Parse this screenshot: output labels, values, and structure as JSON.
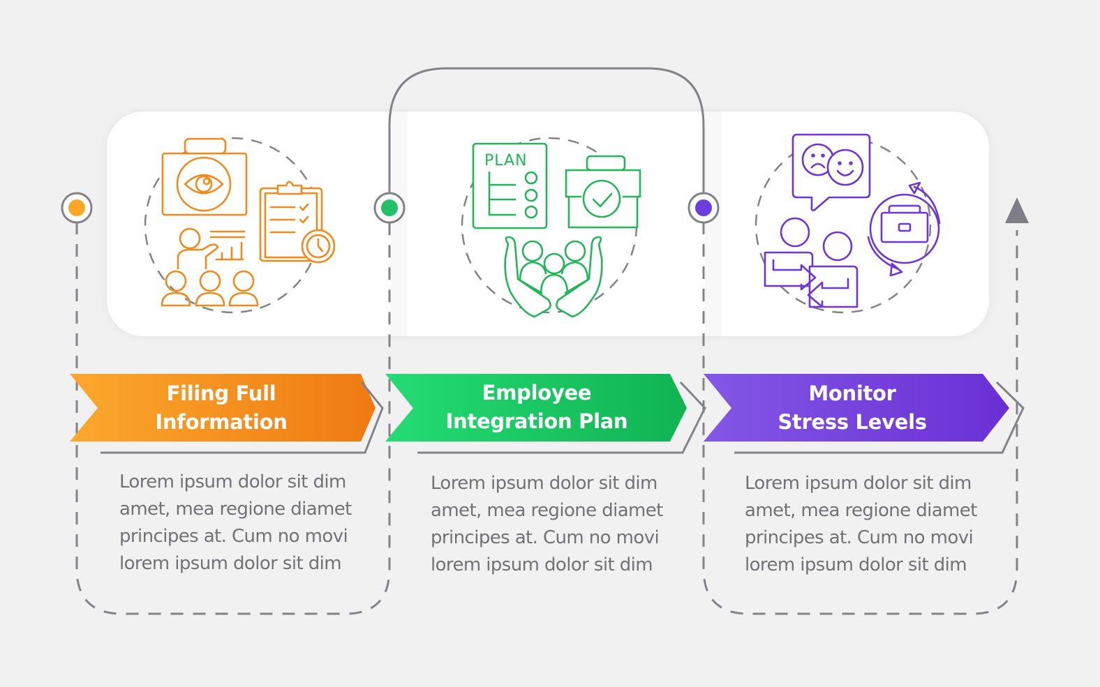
{
  "infographic": {
    "steps": [
      {
        "title_line1": "Filing Full",
        "title_line2": "Information",
        "description": "Lorem ipsum dolor sit dim amet, mea regione diamet principes at. Cum no movi lorem ipsum dolor sit dim",
        "icon": "camera-eye-clipboard-presentation-icon",
        "color": "#f08a1c",
        "gradient": [
          "#fba82e",
          "#ef7a12"
        ],
        "dot_color": "#f9a825"
      },
      {
        "title_line1": "Employee",
        "title_line2": "Integration Plan",
        "description": "Lorem ipsum dolor sit dim amet, mea regione diamet principes at. Cum no movi lorem ipsum dolor sit dim",
        "icon": "plan-briefcase-hands-team-icon",
        "icon_text": "PLAN",
        "color": "#22b559",
        "gradient": [
          "#24dc74",
          "#11b352"
        ],
        "dot_color": "#22c168"
      },
      {
        "title_line1": "Monitor",
        "title_line2": "Stress Levels",
        "description": "Lorem ipsum dolor sit dim amet, mea regione diamet principes at. Cum no movi lorem ipsum dolor sit dim",
        "icon": "mood-exchange-briefcase-cycle-icon",
        "color": "#6d35d6",
        "gradient": [
          "#8357e6",
          "#6a2fd4"
        ],
        "dot_color": "#6c3ee0"
      }
    ],
    "line_color": "#838287",
    "arrow_icon": "arrow-up-icon"
  }
}
